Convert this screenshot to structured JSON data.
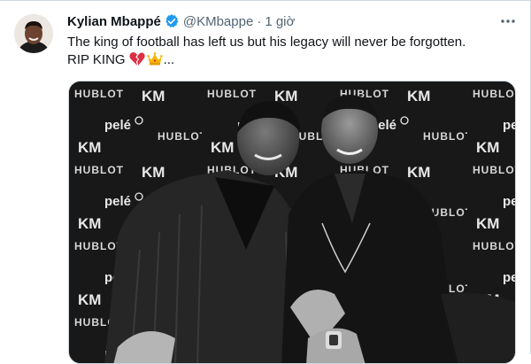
{
  "tweet": {
    "author": {
      "display_name": "Kylian Mbappé",
      "handle": "@KMbappe",
      "verified": true,
      "avatar_icon": "profile-photo-icon"
    },
    "separator": "·",
    "time": "1 giờ",
    "more_icon": "more-horizontal-icon",
    "text_line1": "The king of football has left us but his legacy will never be forgotten.",
    "text_line2": "RIP KING",
    "emojis": [
      "broken-heart-icon",
      "crown-icon"
    ],
    "text_trailing": "...",
    "media": {
      "kind": "photo",
      "backdrop_logos": [
        "HUBLOT",
        "KM",
        "pelé"
      ]
    }
  },
  "colors": {
    "verified_blue": "#1d9bf0",
    "text_primary": "#0f1419",
    "text_secondary": "#536471",
    "border": "#cfd9de"
  }
}
